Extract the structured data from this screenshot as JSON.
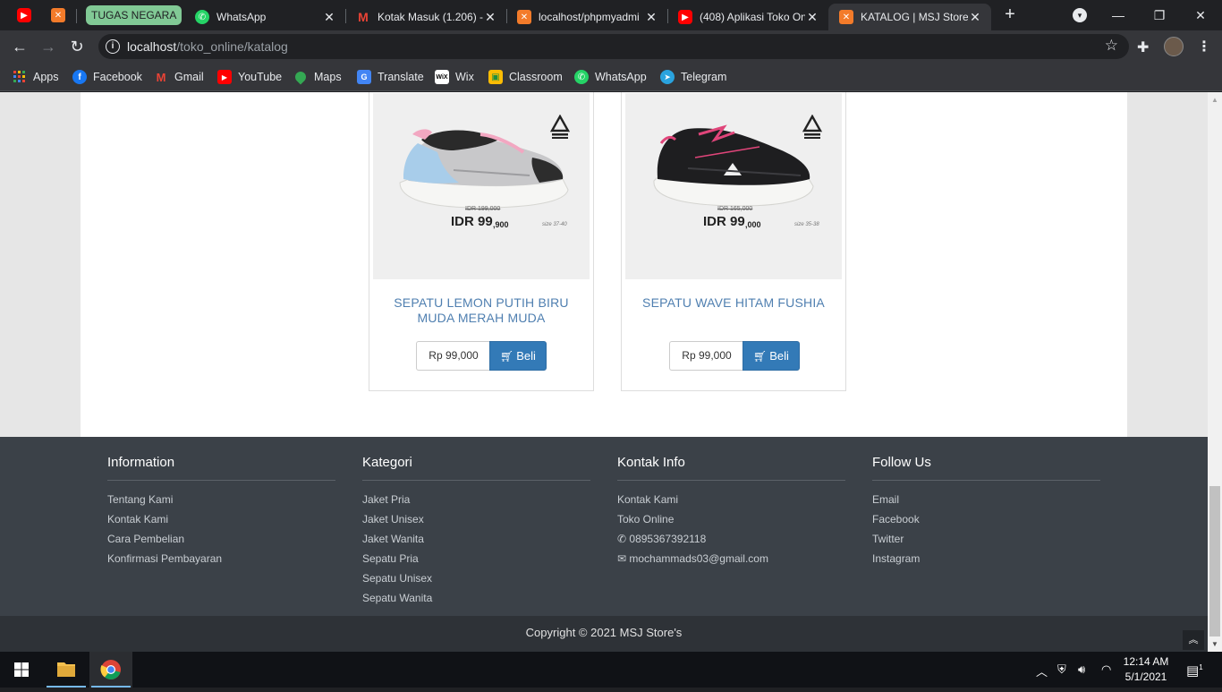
{
  "browser": {
    "tabs": [
      {
        "title": "",
        "icon": "youtube-icon"
      },
      {
        "title": "",
        "icon": "xampp-icon"
      },
      {
        "title": "WhatsApp",
        "icon": "whatsapp-icon"
      },
      {
        "title": "Kotak Masuk (1.206) -",
        "icon": "gmail-icon"
      },
      {
        "title": "localhost/phpmyadmi",
        "icon": "xampp-icon"
      },
      {
        "title": "(408) Aplikasi Toko On",
        "icon": "youtube-icon"
      },
      {
        "title": "KATALOG | MSJ Store'",
        "icon": "xampp-icon",
        "active": true
      }
    ],
    "tab_group_label": "TUGAS NEGARA",
    "address": {
      "host": "localhost",
      "path": "/toko_online/katalog"
    },
    "bookmarks": [
      "Apps",
      "Facebook",
      "Gmail",
      "YouTube",
      "Maps",
      "Translate",
      "Wix",
      "Classroom",
      "WhatsApp",
      "Telegram"
    ]
  },
  "products": [
    {
      "name": "SEPATU LEMON PUTIH BIRU MUDA MERAH MUDA",
      "price": "Rp 99,000",
      "buy_label": "Beli",
      "image": {
        "old_price": "IDR 199,000",
        "price_main": "IDR 99",
        "price_cents": ",900",
        "size": "size 37-40",
        "colors": [
          "#c8c8ca",
          "#f2a7c1",
          "#a8cdea",
          "#2a2a2a"
        ]
      }
    },
    {
      "name": "SEPATU WAVE HITAM FUSHIA",
      "price": "Rp 99,000",
      "buy_label": "Beli",
      "image": {
        "old_price": "IDR 165,000",
        "price_main": "IDR 99",
        "price_cents": ",000",
        "size": "size 35-38",
        "colors": [
          "#1e1e20",
          "#e0457a"
        ]
      }
    }
  ],
  "footer": {
    "information": {
      "title": "Information",
      "links": [
        "Tentang Kami",
        "Kontak Kami",
        "Cara Pembelian",
        "Konfirmasi Pembayaran"
      ]
    },
    "kategori": {
      "title": "Kategori",
      "links": [
        "Jaket Pria",
        "Jaket Unisex",
        "Jaket Wanita",
        "Sepatu Pria",
        "Sepatu Unisex",
        "Sepatu Wanita"
      ]
    },
    "kontak": {
      "title": "Kontak Info",
      "links": [
        "Kontak Kami",
        "Toko Online"
      ],
      "phone": "0895367392118",
      "email": "mochammads03@gmail.com"
    },
    "follow": {
      "title": "Follow Us",
      "links": [
        "Email",
        "Facebook",
        "Twitter",
        "Instagram"
      ]
    },
    "copyright": "Copyright © 2021 MSJ Store's"
  },
  "taskbar": {
    "time": "12:14 AM",
    "date": "5/1/2021",
    "notifications": "1"
  }
}
